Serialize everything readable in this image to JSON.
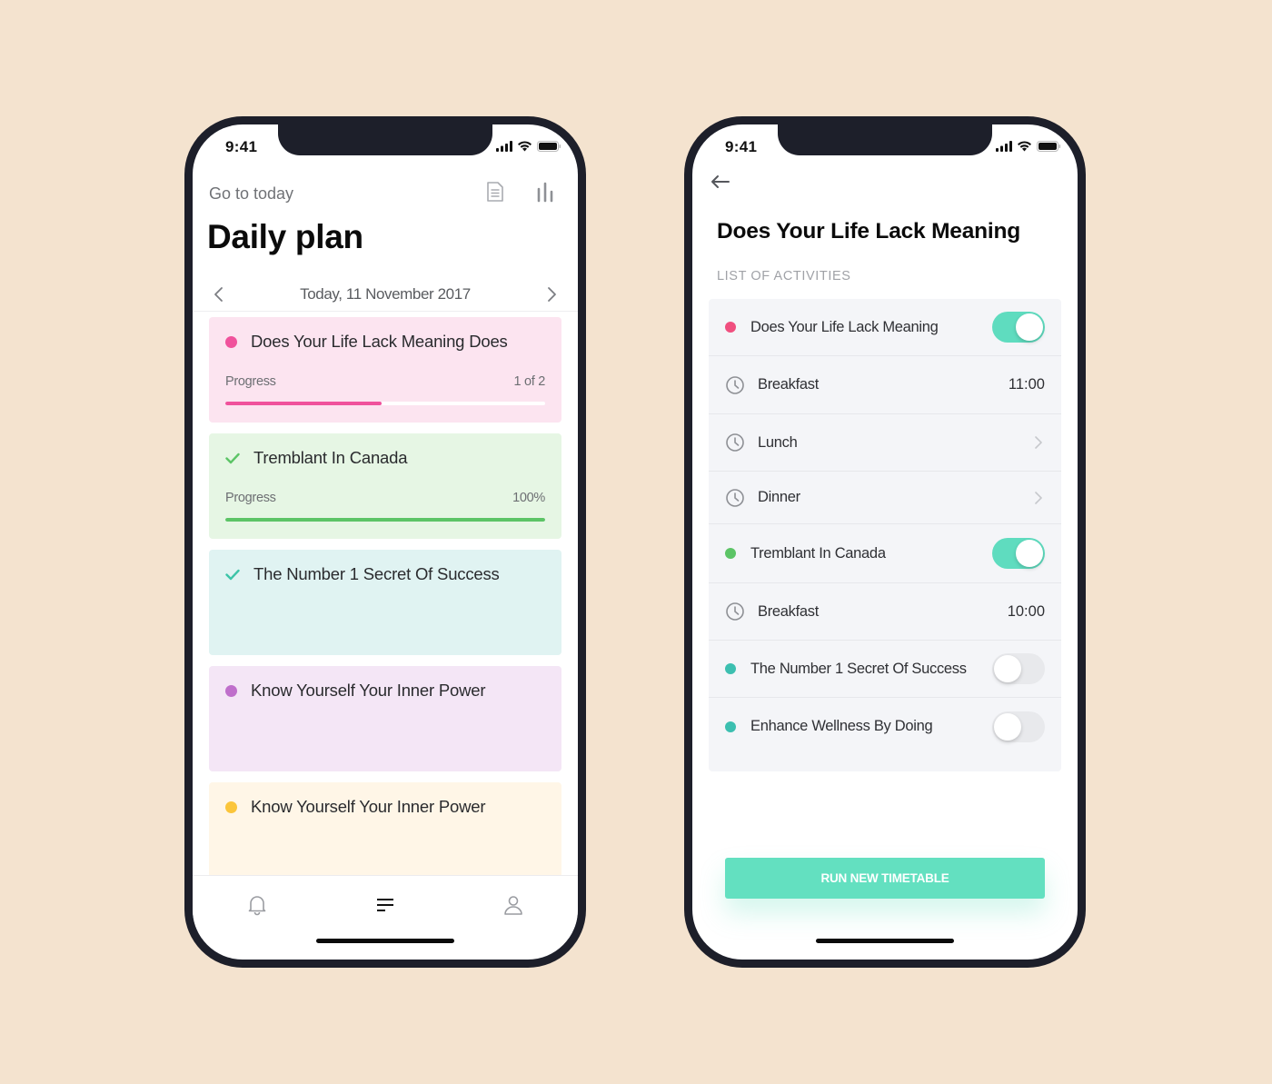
{
  "status_bar": {
    "time": "9:41"
  },
  "daily_plan": {
    "go_today_label": "Go to today",
    "title": "Daily plan",
    "date_label": "Today, 11 November 2017",
    "cards": [
      {
        "title": "Does Your Life Lack Meaning Does",
        "marker": "dot",
        "bg": "#fce4f0",
        "accent": "#f0529c",
        "progress_label": "Progress",
        "progress_value": "1 of 2",
        "progress_fraction": 0.49
      },
      {
        "title": "Tremblant In Canada",
        "marker": "check",
        "bg": "#e6f6e4",
        "accent": "#5cc466",
        "progress_label": "Progress",
        "progress_value": "100%",
        "progress_fraction": 1.0
      },
      {
        "title": "The Number 1 Secret Of Success",
        "marker": "check",
        "bg": "#e0f3f2",
        "accent": "#3cc4a8"
      },
      {
        "title": "Know Yourself Your Inner Power",
        "marker": "dot",
        "bg": "#f4e6f6",
        "accent": "#bf6fcb"
      },
      {
        "title": "Know Yourself Your Inner Power",
        "marker": "dot",
        "bg": "#fff6e7",
        "accent": "#fbc53b"
      }
    ],
    "tabs": [
      {
        "name": "notifications",
        "icon": "bell-icon",
        "active": false
      },
      {
        "name": "plan",
        "icon": "list-icon",
        "active": true
      },
      {
        "name": "profile",
        "icon": "user-icon",
        "active": false
      }
    ]
  },
  "detail": {
    "title": "Does Your Life Lack Meaning",
    "section_label": "LIST OF ACTIVITIES",
    "rows": [
      {
        "type": "activity",
        "label": "Does Your Life Lack Meaning",
        "dot_color": "#f04f7f",
        "toggle": true
      },
      {
        "type": "meal",
        "label": "Breakfast",
        "time": "11:00"
      },
      {
        "type": "meal",
        "label": "Lunch",
        "chevron": true
      },
      {
        "type": "meal",
        "label": "Dinner",
        "chevron": true
      },
      {
        "type": "activity",
        "label": "Tremblant In Canada",
        "dot_color": "#5cc466",
        "toggle": true
      },
      {
        "type": "meal",
        "label": "Breakfast",
        "time": "10:00"
      },
      {
        "type": "activity",
        "label": "The Number 1 Secret Of Success",
        "dot_color": "#3cbfb0",
        "toggle": false
      },
      {
        "type": "activity",
        "label": "Enhance Wellness By Doing",
        "dot_color": "#3cbfb0",
        "toggle": false
      }
    ],
    "run_button_label": "RUN NEW TIMETABLE"
  },
  "colors": {
    "background": "#f4e3cf",
    "phone_frame": "#1d1f2a",
    "toggle_on": "#5fdcbf",
    "button": "#63e0c0"
  }
}
